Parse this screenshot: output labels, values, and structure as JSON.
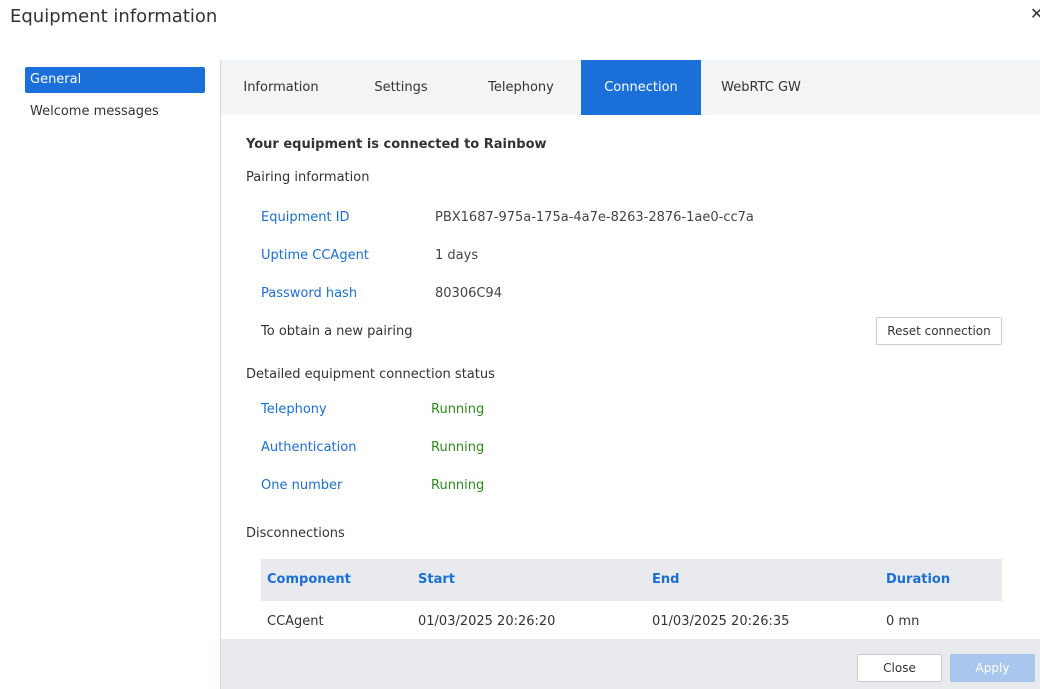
{
  "dialog": {
    "title": "Equipment information"
  },
  "sidebar": {
    "items": [
      {
        "label": "General"
      },
      {
        "label": "Welcome messages"
      }
    ]
  },
  "tabs": [
    {
      "label": "Information"
    },
    {
      "label": "Settings"
    },
    {
      "label": "Telephony"
    },
    {
      "label": "Connection"
    },
    {
      "label": "WebRTC GW"
    }
  ],
  "connection": {
    "status_title": "Your equipment is connected to Rainbow",
    "pairing_heading": "Pairing information",
    "pairing": [
      {
        "label": "Equipment ID",
        "value": "PBX1687-975a-175a-4a7e-8263-2876-1ae0-cc7a"
      },
      {
        "label": "Uptime CCAgent",
        "value": "1 days"
      },
      {
        "label": "Password hash",
        "value": "80306C94"
      }
    ],
    "new_pairing_label": "To obtain a new pairing",
    "reset_button": "Reset connection",
    "status_heading": "Detailed equipment connection status",
    "statuses": [
      {
        "label": "Telephony",
        "value": "Running"
      },
      {
        "label": "Authentication",
        "value": "Running"
      },
      {
        "label": "One number",
        "value": "Running"
      }
    ],
    "disconnections_heading": "Disconnections",
    "table": {
      "headers": [
        "Component",
        "Start",
        "End",
        "Duration"
      ],
      "rows": [
        [
          "CCAgent",
          "01/03/2025 20:26:20",
          "01/03/2025 20:26:35",
          "0 mn"
        ]
      ]
    }
  },
  "footer": {
    "close_label": "Close",
    "apply_label": "Apply"
  },
  "colors": {
    "accent": "#1a6fd8",
    "running": "#2e8b1e",
    "apply_disabled": "#a9c6ee"
  }
}
